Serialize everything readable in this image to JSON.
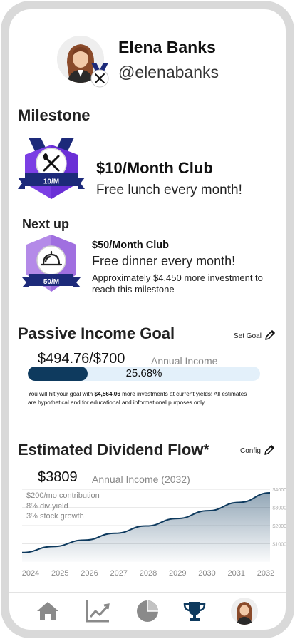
{
  "profile": {
    "name": "Elena Banks",
    "handle": "@elenabanks"
  },
  "milestone": {
    "section_title": "Milestone",
    "badge_label": "10/M",
    "title": "$10/Month Club",
    "subtitle": "Free lunch every month!"
  },
  "next_up": {
    "section_title": "Next up",
    "badge_label": "50/M",
    "title": "$50/Month Club",
    "subtitle": "Free dinner every month!",
    "note": "Approximately $4,450 more investment to reach this milestone"
  },
  "passive_income": {
    "section_title": "Passive Income Goal",
    "action_label": "Set Goal",
    "amount": "$494.76/$700",
    "amount_label": "Annual Income",
    "progress_percent": 25.68,
    "progress_text": "25.68%",
    "note_prefix": "You will hit your goal with ",
    "note_amount": "$4,564.06",
    "note_suffix": " more investments at current yields! All estimates are hypothetical and for educational and informational purposes only"
  },
  "dividend_flow": {
    "section_title": "Estimated Dividend Flow*",
    "action_label": "Config",
    "amount": "$3809",
    "amount_label": "Annual Income (2032)",
    "assumptions": [
      "$200/mo contribution",
      "8% div yield",
      "3% stock growth"
    ]
  },
  "chart_data": {
    "type": "area",
    "x": [
      "2024",
      "2025",
      "2026",
      "2027",
      "2028",
      "2029",
      "2030",
      "2031",
      "2032"
    ],
    "values": [
      520,
      850,
      1200,
      1580,
      1980,
      2390,
      2820,
      3280,
      3809
    ],
    "y_ticks": [
      "$4000",
      "$3000",
      "$2000",
      "$1000"
    ],
    "ylim": [
      0,
      4200
    ],
    "grid": true,
    "line_color": "#0e3a5e"
  },
  "nav": {
    "items": [
      "home-icon",
      "chart-icon",
      "pie-chart-icon",
      "trophy-icon",
      "avatar"
    ],
    "active": "trophy-icon",
    "active_color": "#0e3a5e",
    "inactive_color": "#8a8a8a"
  },
  "colors": {
    "badge_purple": "#7b3fe4",
    "badge_navy": "#1d2a7a",
    "progress_fill": "#0e3a5e",
    "progress_track": "#e3f0fa"
  }
}
